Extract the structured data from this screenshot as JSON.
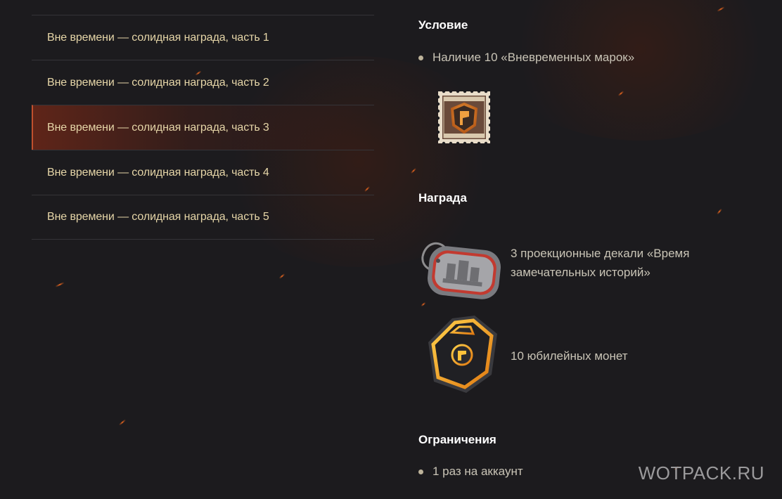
{
  "menu": {
    "items": [
      {
        "label": "Вне времени — солидная награда, часть 1",
        "active": false
      },
      {
        "label": "Вне времени — солидная награда, часть 2",
        "active": false
      },
      {
        "label": "Вне времени — солидная награда, часть 3",
        "active": true
      },
      {
        "label": "Вне времени — солидная награда, часть 4",
        "active": false
      },
      {
        "label": "Вне времени — солидная награда, часть 5",
        "active": false
      }
    ]
  },
  "condition": {
    "heading": "Условие",
    "items": [
      "Наличие 10 «Вневременных марок»"
    ],
    "icon": "stamp-icon"
  },
  "reward": {
    "heading": "Награда",
    "items": [
      {
        "text": "3 проекционные декали «Время замечательных историй»",
        "icon": "dogtag-decal-icon"
      },
      {
        "text": "10 юбилейных монет",
        "icon": "jubilee-coin-icon"
      }
    ]
  },
  "limits": {
    "heading": "Ограничения",
    "items": [
      "1 раз на аккаунт"
    ]
  },
  "watermark": "WOTPACK.RU",
  "colors": {
    "background": "#1c1b1e",
    "menu_text": "#e6d6a8",
    "active_accent": "#c0502e",
    "body_text": "#c9c4b6"
  }
}
